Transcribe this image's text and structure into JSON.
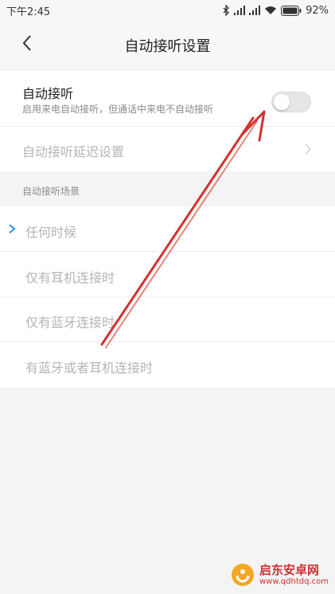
{
  "status_bar": {
    "time": "下午2:45",
    "battery_percent": "92%",
    "icons": [
      "bluetooth-icon",
      "signal-icon",
      "signal-icon",
      "wifi-icon",
      "battery-icon"
    ]
  },
  "header": {
    "title": "自动接听设置",
    "back_icon": "chevron-left-icon"
  },
  "auto_answer": {
    "title": "自动接听",
    "subtitle": "启用来电自动接听，但通话中来电不自动接听",
    "toggle_on": false
  },
  "delay_setting": {
    "label": "自动接听延迟设置",
    "enabled": false
  },
  "scenes": {
    "header": "自动接听场景",
    "options": [
      {
        "label": "任何时候",
        "selected": true
      },
      {
        "label": "仅有耳机连接时",
        "selected": false
      },
      {
        "label": "仅有蓝牙连接时",
        "selected": false
      },
      {
        "label": "有蓝牙或者耳机连接时",
        "selected": false
      }
    ]
  },
  "watermark": {
    "title": "启东安卓网",
    "url": "www.qdhtdq.com"
  },
  "colors": {
    "accent": "#2196f3",
    "annotation_red": "#d0332b",
    "disabled_text": "#b5b5b5"
  }
}
